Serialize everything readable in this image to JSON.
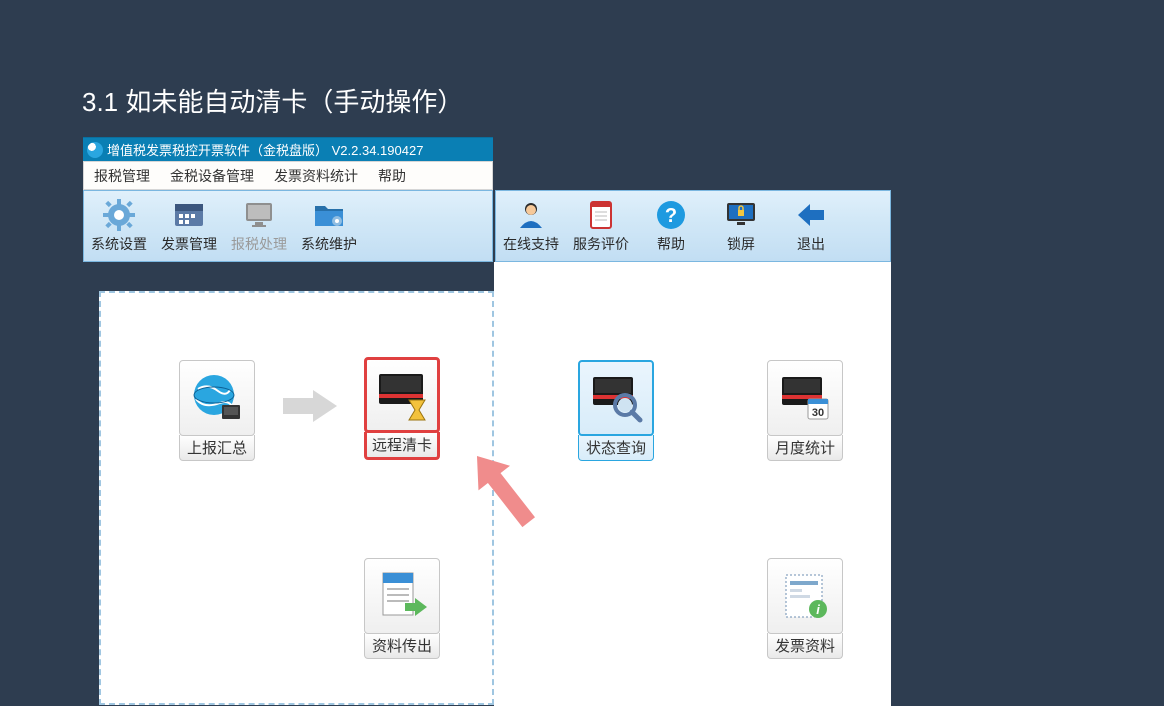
{
  "heading": "3.1  如未能自动清卡（手动操作）",
  "titlebar": {
    "text": "增值税发票税控开票软件（金税盘版）  V2.2.34.190427"
  },
  "menubar": {
    "items": [
      "报税管理",
      "金税设备管理",
      "发票资料统计",
      "帮助"
    ]
  },
  "toolbar_left": {
    "items": [
      {
        "label": "系统设置",
        "icon": "gear"
      },
      {
        "label": "发票管理",
        "icon": "calendar"
      },
      {
        "label": "报税处理",
        "icon": "monitor",
        "disabled": true
      },
      {
        "label": "系统维护",
        "icon": "folder"
      }
    ]
  },
  "toolbar_right": {
    "items": [
      {
        "label": "在线支持",
        "icon": "person"
      },
      {
        "label": "服务评价",
        "icon": "notebook"
      },
      {
        "label": "帮助",
        "icon": "help"
      },
      {
        "label": "锁屏",
        "icon": "lock"
      },
      {
        "label": "退出",
        "icon": "back"
      }
    ]
  },
  "cells": {
    "upload_summary": "上报汇总",
    "remote_clear": "远程清卡",
    "data_export": "资料传出",
    "status_query": "状态查询",
    "monthly_stats": "月度统计",
    "invoice_data": "发票资料"
  }
}
